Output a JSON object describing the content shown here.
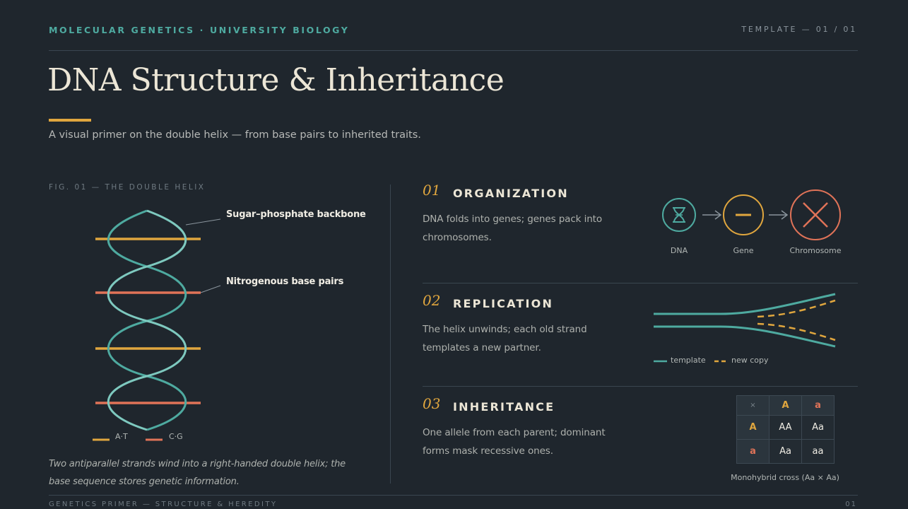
{
  "header": {
    "kicker": "MOLECULAR GENETICS · UNIVERSITY BIOLOGY",
    "page_indicator": "TEMPLATE — 01 / 01"
  },
  "title": "DNA Structure & Inheritance",
  "subtitle": "A visual primer on the double helix — from base pairs to inherited traits.",
  "figure": {
    "label": "FIG. 01 — THE DOUBLE HELIX",
    "callouts": {
      "backbone": "Sugar–phosphate backbone",
      "base_pairs": "Nitrogenous base pairs"
    },
    "legend": [
      {
        "label": "A·T",
        "color": "#e0a63e"
      },
      {
        "label": "C·G",
        "color": "#e07358"
      }
    ],
    "caption": "Two antiparallel strands wind into a right-handed double helix; the base sequence stores genetic information."
  },
  "colors": {
    "accent_teal": "#4eaaa0",
    "accent_gold": "#e0a63e",
    "accent_coral": "#e07358",
    "background": "#1f262d"
  },
  "sections": [
    {
      "number": "01",
      "title": "ORGANIZATION",
      "body": "DNA folds into genes; genes pack into chromosomes.",
      "diagram": {
        "nodes": [
          {
            "label": "DNA",
            "icon": "hourglass-helix-icon"
          },
          {
            "label": "Gene",
            "icon": "minus-icon"
          },
          {
            "label": "Chromosome",
            "icon": "x-chromosome-icon"
          }
        ]
      }
    },
    {
      "number": "02",
      "title": "REPLICATION",
      "body": "The helix unwinds; each old strand templates a new partner.",
      "diagram": {
        "legend": [
          {
            "label": "template",
            "style": "solid"
          },
          {
            "label": "new copy",
            "style": "dashed"
          }
        ]
      }
    },
    {
      "number": "03",
      "title": "INHERITANCE",
      "body": "One allele from each parent; dominant forms mask recessive ones.",
      "punnett": {
        "corner": "×",
        "cols": [
          "A",
          "a"
        ],
        "rows": [
          {
            "header": "A",
            "cells": [
              "AA",
              "Aa"
            ]
          },
          {
            "header": "a",
            "cells": [
              "Aa",
              "aa"
            ]
          }
        ],
        "caption": "Monohybrid cross (Aa × Aa)"
      }
    }
  ],
  "footer": {
    "left": "GENETICS PRIMER — STRUCTURE & HEREDITY",
    "right": "01"
  }
}
